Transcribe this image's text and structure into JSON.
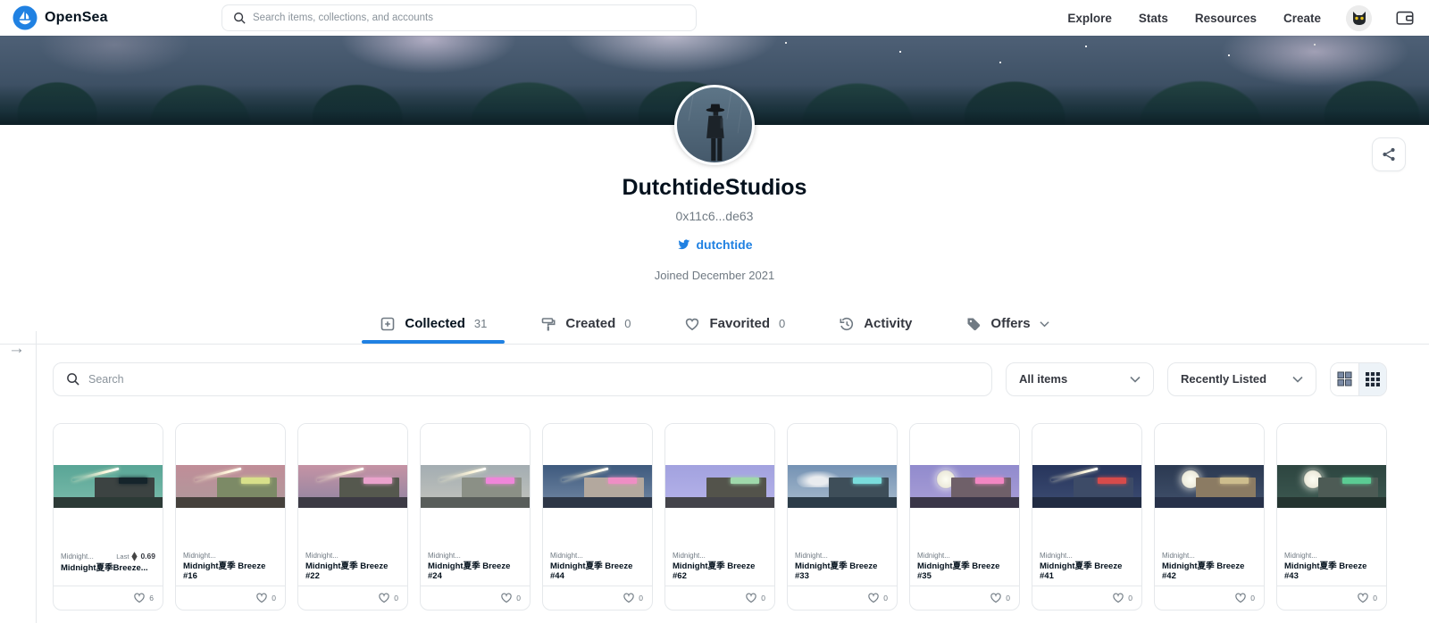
{
  "brand": {
    "name": "OpenSea"
  },
  "header": {
    "search_placeholder": "Search items, collections, and accounts",
    "nav": [
      {
        "label": "Explore"
      },
      {
        "label": "Stats"
      },
      {
        "label": "Resources"
      },
      {
        "label": "Create"
      }
    ]
  },
  "profile": {
    "name": "DutchtideStudios",
    "address": "0x11c6...de63",
    "twitter_handle": "dutchtide",
    "joined": "Joined December 2021"
  },
  "tabs": {
    "collected": {
      "label": "Collected",
      "count": "31"
    },
    "created": {
      "label": "Created",
      "count": "0"
    },
    "favorited": {
      "label": "Favorited",
      "count": "0"
    },
    "activity": {
      "label": "Activity"
    },
    "offers": {
      "label": "Offers"
    }
  },
  "filters": {
    "search_placeholder": "Search",
    "category_selected": "All items",
    "sort_selected": "Recently Listed"
  },
  "colors": {
    "accent": "#2081e2",
    "text_dark": "#04111d",
    "text_gray": "#707a83",
    "border": "#e5e8eb"
  },
  "cards": [
    {
      "collection": "Midnight...",
      "title": "Midnight夏季Breeze...",
      "last_label": "Last",
      "last_price": "0.69",
      "likes": "6",
      "art": {
        "sky": [
          "#59a596",
          "#7bbcab"
        ],
        "ground": "#2c3a36",
        "building": "#3c4342",
        "sign": "#15242b",
        "comet": true
      }
    },
    {
      "collection": "Midnight...",
      "title": "Midnight夏季 Breeze #16",
      "likes": "0",
      "art": {
        "sky": [
          "#c08d98",
          "#ae9a9c"
        ],
        "ground": "#45413c",
        "building": "#7c8a66",
        "sign": "#d8e08a",
        "comet": true
      }
    },
    {
      "collection": "Midnight...",
      "title": "Midnight夏季 Breeze #22",
      "likes": "0",
      "art": {
        "sky": [
          "#c593a4",
          "#8e84a2"
        ],
        "ground": "#3c3a44",
        "building": "#55584e",
        "sign": "#eaa2cc",
        "comet": true
      }
    },
    {
      "collection": "Midnight...",
      "title": "Midnight夏季 Breeze #24",
      "likes": "0",
      "art": {
        "sky": [
          "#a3adb2",
          "#c3c4bd"
        ],
        "ground": "#585d5a",
        "building": "#8b9086",
        "sign": "#ef86da",
        "comet": true
      }
    },
    {
      "collection": "Midnight...",
      "title": "Midnight夏季 Breeze #44",
      "likes": "0",
      "art": {
        "sky": [
          "#3e5a7e",
          "#7388a4"
        ],
        "ground": "#2d3646",
        "building": "#b3a89e",
        "sign": "#ee8ec4",
        "comet": true
      }
    },
    {
      "collection": "Midnight...",
      "title": "Midnight夏季 Breeze #62",
      "likes": "0",
      "art": {
        "sky": [
          "#a2a2df",
          "#b6b3ea"
        ],
        "ground": "#44444a",
        "building": "#53534b",
        "sign": "#9fd8ab"
      }
    },
    {
      "collection": "Midnight...",
      "title": "Midnight夏季 Breeze #33",
      "likes": "0",
      "art": {
        "sky": [
          "#7492b4",
          "#a9bccd"
        ],
        "ground": "#2c3c48",
        "building": "#3e4e59",
        "sign": "#7adcdc",
        "cloud": true
      }
    },
    {
      "collection": "Midnight...",
      "title": "Midnight夏季 Breeze #35",
      "likes": "0",
      "art": {
        "sky": [
          "#918bcd",
          "#a99ed7"
        ],
        "ground": "#3a3648",
        "building": "#6f6069",
        "sign": "#f287c3",
        "moon": true
      }
    },
    {
      "collection": "Midnight...",
      "title": "Midnight夏季 Breeze #41",
      "likes": "0",
      "art": {
        "sky": [
          "#27355c",
          "#3d4d73"
        ],
        "ground": "#212b42",
        "building": "#3d4b67",
        "sign": "#d64b4b",
        "comet": true
      }
    },
    {
      "collection": "Midnight...",
      "title": "Midnight夏季 Breeze #42",
      "likes": "0",
      "art": {
        "sky": [
          "#2b3951",
          "#41516c"
        ],
        "ground": "#273149",
        "building": "#8b7b63",
        "sign": "#cdbd8d",
        "moon": true
      }
    },
    {
      "collection": "Midnight...",
      "title": "Midnight夏季 Breeze #43",
      "likes": "0",
      "art": {
        "sky": [
          "#2d4540",
          "#3d5951"
        ],
        "ground": "#243430",
        "building": "#4d5b55",
        "sign": "#5bcb93",
        "moon": true
      }
    }
  ]
}
